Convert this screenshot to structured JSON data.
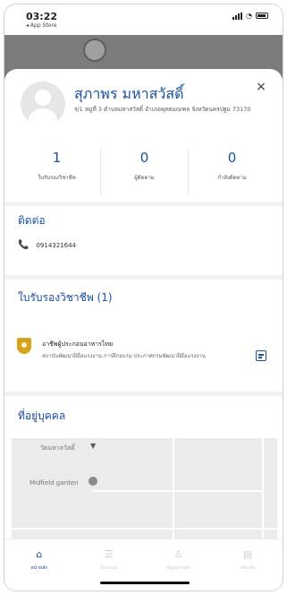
{
  "status_bar": {
    "time": "03:22",
    "back_app": "◂ App Store"
  },
  "profile": {
    "name": "สุภาพร มหาสวัสดิ์",
    "address": "ร/1 หมู่ที่ 3 ตำบลมหาสวัสดิ์ อำเภอพุทธมณฑล จังหวัดนครปฐม 73170",
    "close_icon": "×"
  },
  "stats": [
    {
      "value": "1",
      "label": "ใบรับรองวิชาชีพ"
    },
    {
      "value": "0",
      "label": "ผู้ติดตาม"
    },
    {
      "value": "0",
      "label": "กำลังติดตาม"
    }
  ],
  "contact": {
    "title": "ติดต่อ",
    "phone_icon": "📞",
    "phone": "0914321644"
  },
  "certificates": {
    "title": "ใบรับรองวิชาชีพ (1)",
    "items": [
      {
        "title": "อาชีพผู้ประกอบอาหารไทย",
        "description": "สถาบันพัฒนาฝีมือแรงงาน การฝึกอบรม ประกาศกรมพัฒนาฝีมือแรงงาน"
      }
    ]
  },
  "location": {
    "title": "ที่อยู่บุคคล",
    "map_labels": [
      "วัดมหาสวัสดิ์",
      "Midfield garden"
    ]
  },
  "tabs": [
    {
      "icon": "home-icon",
      "glyph": "⌂",
      "label": "หน้าหลัก",
      "active": true
    },
    {
      "icon": "list-icon",
      "glyph": "☰",
      "label": "ใบรับรอง",
      "active": false
    },
    {
      "icon": "person-icon",
      "glyph": "♙",
      "label": "ข้อมูลส่วนตัว",
      "active": false
    },
    {
      "icon": "document-icon",
      "glyph": "▤",
      "label": "เพิ่มเติม",
      "active": false
    }
  ]
}
